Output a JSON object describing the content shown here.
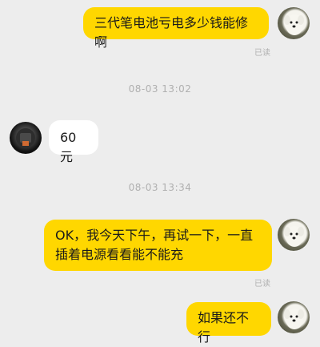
{
  "messages": [
    {
      "side": "mine",
      "text": "三代笔电池亏电多少钱能修啊",
      "status": "已读"
    },
    {
      "type": "timestamp",
      "text": "08-03 13:02"
    },
    {
      "side": "theirs",
      "text": "60元"
    },
    {
      "type": "timestamp",
      "text": "08-03 13:34"
    },
    {
      "side": "mine",
      "text": "OK，我今天下午，再试一下，一直插着电源看看能不能充",
      "status": "已读"
    },
    {
      "side": "mine",
      "text": "如果还不行"
    }
  ],
  "avatars": {
    "me": "white-dog-avatar",
    "other": "dark-avatar"
  }
}
